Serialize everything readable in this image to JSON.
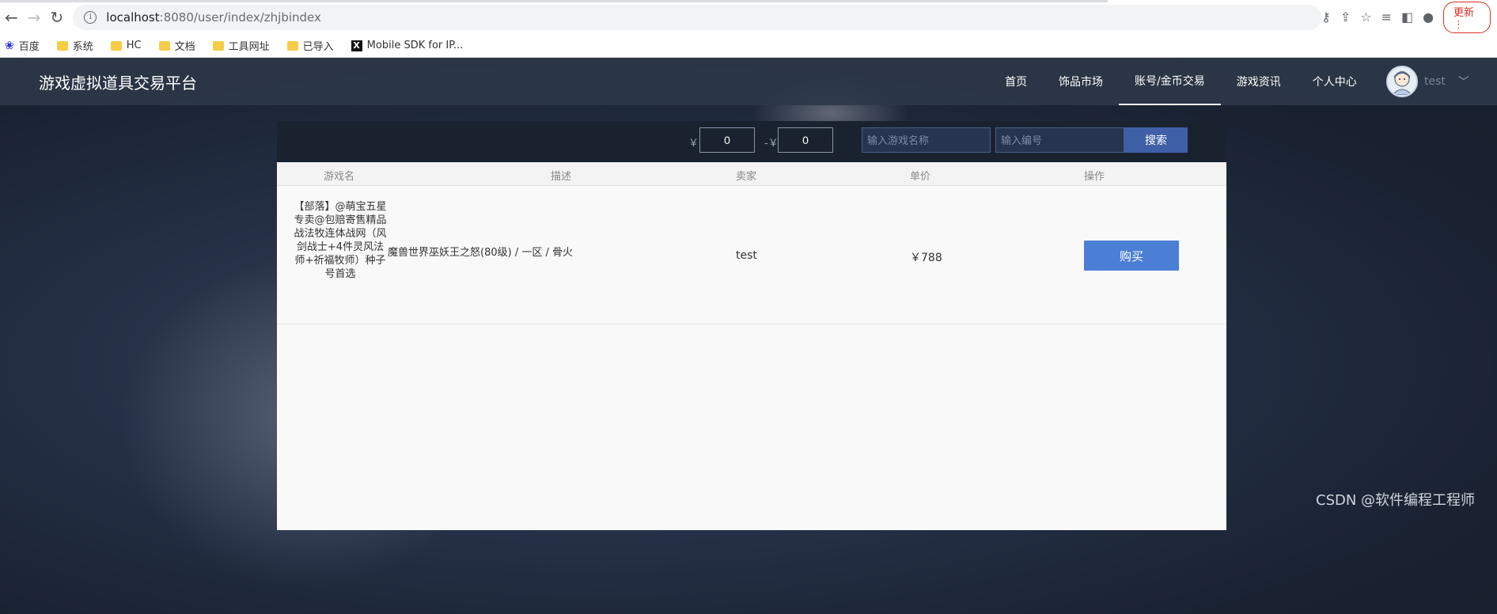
{
  "browser": {
    "url_host": "localhost",
    "url_path": ":8080/user/index/zhjbindex",
    "update_label": "更新",
    "bookmarks": [
      {
        "label": "百度",
        "icon": "paw-icon"
      },
      {
        "label": "系统",
        "icon": "folder-icon"
      },
      {
        "label": "HC",
        "icon": "folder-icon"
      },
      {
        "label": "文档",
        "icon": "folder-icon"
      },
      {
        "label": "工具网址",
        "icon": "folder-icon"
      },
      {
        "label": "已导入",
        "icon": "folder-icon"
      },
      {
        "label": "Mobile SDK for IP...",
        "icon": "x-logo-icon"
      }
    ]
  },
  "header": {
    "site_title": "游戏虚拟道具交易平台",
    "nav": [
      {
        "label": "首页"
      },
      {
        "label": "饰品市场"
      },
      {
        "label": "账号/金币交易",
        "active": true
      },
      {
        "label": "游戏资讯"
      },
      {
        "label": "个人中心"
      }
    ],
    "username": "test"
  },
  "filter": {
    "min_prefix": "￥",
    "min_value": "0",
    "max_prefix": "-￥",
    "max_value": "0",
    "game_placeholder": "输入游戏名称",
    "code_placeholder": "输入编号",
    "search_label": "搜索"
  },
  "table": {
    "headers": [
      "游戏名",
      "描述",
      "卖家",
      "单价",
      "操作"
    ],
    "rows": [
      {
        "name": "【部落】@萌宝五星专卖@包赔寄售精品战法牧连体战网（风剑战士+4件灵风法师+祈福牧师）种子号首选",
        "description": "魔兽世界巫妖王之怒(80级) / 一区 / 骨火",
        "seller": "test",
        "price": "￥788",
        "action": "购买"
      }
    ]
  },
  "watermark": "CSDN @软件编程工程师"
}
